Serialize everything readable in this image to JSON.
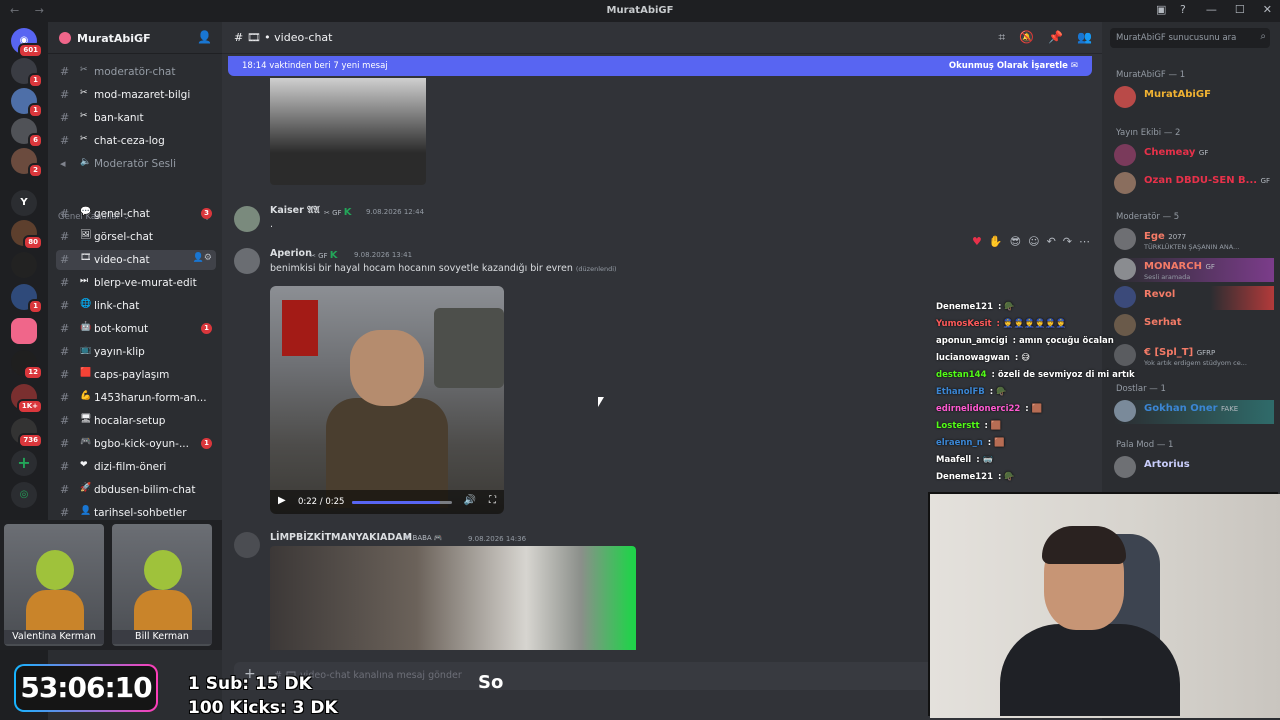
{
  "window": {
    "title": "MuratAbiGF"
  },
  "rail": {
    "badges": [
      "601",
      "1",
      "1",
      "6",
      "2",
      "80",
      "1",
      "12",
      "1K+",
      "736"
    ]
  },
  "server": {
    "name": "MuratAbiGF"
  },
  "channels_top": [
    {
      "emoji": "✂",
      "name": "moderatör-chat",
      "dim": true
    },
    {
      "emoji": "✂",
      "name": "mod-mazaret-bilgi"
    },
    {
      "emoji": "✂",
      "name": "ban-kanıt"
    },
    {
      "emoji": "✂",
      "name": "chat-ceza-log"
    },
    {
      "emoji": "🔈",
      "name": "Moderatör Sesli",
      "dim": true
    }
  ],
  "category": {
    "name": "Genel Kanallar"
  },
  "channels": [
    {
      "emoji": "💬",
      "name": "genel-chat",
      "badge": "3"
    },
    {
      "emoji": "🖼",
      "name": "görsel-chat"
    },
    {
      "emoji": "🎞",
      "name": "video-chat",
      "active": true
    },
    {
      "emoji": "⏭",
      "name": "blerp-ve-murat-edit"
    },
    {
      "emoji": "🌐",
      "name": "link-chat"
    },
    {
      "emoji": "🤖",
      "name": "bot-komut",
      "badge": "1"
    },
    {
      "emoji": "📺",
      "name": "yayın-klip"
    },
    {
      "emoji": "🟥",
      "name": "caps-paylaşım"
    },
    {
      "emoji": "💪",
      "name": "1453harun-form-an..."
    },
    {
      "emoji": "🖥",
      "name": "hocalar-setup"
    },
    {
      "emoji": "🎮",
      "name": "bgbo-kick-oyun-...",
      "badge": "1"
    },
    {
      "emoji": "❤",
      "name": "dizi-film-öneri"
    },
    {
      "emoji": "🚀",
      "name": "dbdusen-bilim-chat"
    },
    {
      "emoji": "👤",
      "name": "tarihsel-sohbetler"
    }
  ],
  "cams": [
    {
      "label": "Valentina Kerman"
    },
    {
      "label": "Bill Kerman"
    }
  ],
  "channel": {
    "name": "video-chat",
    "composer_placeholder": "video-chat kanalına mesaj gönder"
  },
  "banner": {
    "text": "18:14 vaktinden beri 7 yeni mesaj",
    "action": "Okunmuş Olarak İşaretle"
  },
  "messages": [
    {
      "author": "Kaiser 𝔄𝔄",
      "tag": "GF",
      "time": "9.08.2026 12:44",
      "text": ".",
      "color": "#7bd88f"
    },
    {
      "author": "Aperion",
      "tag": "GF",
      "time": "9.08.2026 13:41",
      "text": "benimkisi bir hayal hocam hocanın sovyetle kazandığı bir evren",
      "edited": "(düzenlendi)",
      "color": "#7bd88f"
    },
    {
      "author": "LİMPBİZKİTMANYAKIADAM",
      "tag": "BABA",
      "time": "9.08.2026 14:36",
      "color": "#f0b232"
    }
  ],
  "video": {
    "time": "0:22 / 0:25",
    "progress": 0.88
  },
  "members": {
    "search_placeholder": "MuratAbiGF sunucusunu ara",
    "groups": [
      {
        "title": "MuratAbiGF — 1",
        "items": [
          {
            "name": "MuratAbiGF",
            "color": "#f0b232"
          }
        ]
      },
      {
        "title": "Yayın Ekibi — 2",
        "items": [
          {
            "name": "Chemeay",
            "tag": "GF",
            "color": "#e8314a"
          },
          {
            "name": "Ozan DBDU-SEN B...",
            "tag": "GF",
            "color": "#e8314a"
          }
        ]
      },
      {
        "title": "Moderatör — 5",
        "items": [
          {
            "name": "Ege",
            "tag": "2077",
            "sub": "TÜRKLÜKTEN ŞAŞANIN ANA...",
            "color": "#f47b67"
          },
          {
            "name": "MONARCH",
            "tag": "GF",
            "sub": "Sesli aramada",
            "color": "#f47b67"
          },
          {
            "name": "Revol",
            "color": "#f47b67"
          },
          {
            "name": "Serhat",
            "color": "#f47b67"
          },
          {
            "name": "€ [Spl_T]",
            "tag": "GFRP",
            "sub": "Yok artık erdigem stüdyom ce...",
            "color": "#f47b67"
          }
        ]
      },
      {
        "title": "Dostlar — 1",
        "items": [
          {
            "name": "Gokhan Oner",
            "tag": "FAKE",
            "color": "#3b86d4"
          }
        ]
      },
      {
        "title": "Pala Mod — 1",
        "items": [
          {
            "name": "Artorius",
            "color": "#c9cdfb"
          }
        ]
      }
    ]
  },
  "stream_chat": [
    {
      "user": "Deneme121",
      "msg": "🪖",
      "color": "#ffffff"
    },
    {
      "user": "YumosKesit",
      "msg": "👮👮👮👮👮👮",
      "color": "#ff5a5a"
    },
    {
      "user": "aponun_amcigi",
      "msg": "amın çocuğu öcalan",
      "color": "#ffffff"
    },
    {
      "user": "lucianowagwan",
      "msg": "😅",
      "color": "#ffffff"
    },
    {
      "user": "destan144",
      "msg": "özeli de sevmiyoz di mi artık",
      "color": "#53fc18"
    },
    {
      "user": "EthanolFB",
      "msg": "🪖",
      "color": "#3b86d4"
    },
    {
      "user": "edirnelidonerci22",
      "msg": "🟫",
      "color": "#ff5ad1"
    },
    {
      "user": "Losterstt",
      "msg": "🟫",
      "color": "#53fc18"
    },
    {
      "user": "elraenn_n",
      "msg": "🟫",
      "color": "#3b86d4"
    },
    {
      "user": "Maafell",
      "msg": "🥽",
      "color": "#ffffff"
    },
    {
      "user": "Deneme121",
      "msg": "🪖",
      "color": "#ffffff"
    }
  ],
  "overlay": {
    "timer": "53:06:10",
    "sub_goal": "1 Sub: 15 DK",
    "kick_goal": "100 Kicks: 3 DK",
    "caption": "So"
  },
  "colors": {
    "accent": "#5865f2",
    "background": "#313338",
    "sidebar": "#2b2d31"
  }
}
